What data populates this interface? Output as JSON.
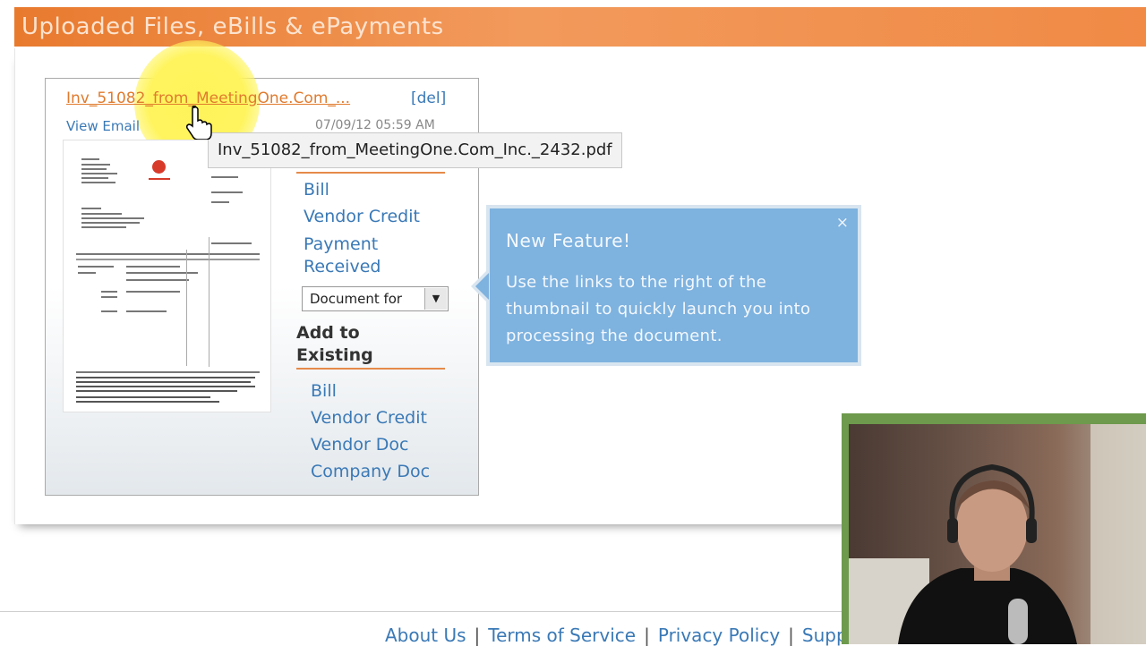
{
  "header": {
    "title": "Uploaded Files, eBills & ePayments"
  },
  "file": {
    "name_truncated": "Inv_51082_from_MeetingOne.Com_...",
    "delete_label": "[del]",
    "view_email_label": "View Email",
    "date": "07/09/12 05:59 AM",
    "tooltip": "Inv_51082_from_MeetingOne.Com_Inc._2432.pdf"
  },
  "create_new": {
    "items": [
      "Bill",
      "Vendor Credit",
      "Payment Received"
    ],
    "document_select": {
      "value": "Document for"
    }
  },
  "add_existing": {
    "heading": "Add to Existing",
    "items": [
      "Bill",
      "Vendor Credit",
      "Vendor Doc",
      "Company Doc"
    ]
  },
  "callout": {
    "title": "New Feature!",
    "body": "Use the links to the right of the thumbnail to quickly launch you into processing the document.",
    "close_icon": "×"
  },
  "footer": {
    "links": [
      "About Us",
      "Terms of Service",
      "Privacy Policy",
      "Suppo"
    ],
    "separator": "|"
  },
  "colors": {
    "accent": "#e87a2e",
    "link": "#3a79b6",
    "callout": "#7eb2df"
  }
}
